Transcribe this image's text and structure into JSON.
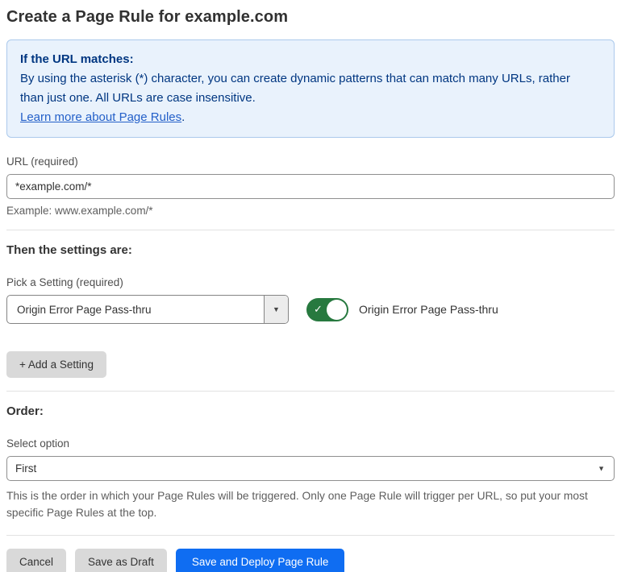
{
  "page": {
    "title": "Create a Page Rule for example.com"
  },
  "info_box": {
    "heading": "If the URL matches:",
    "body": "By using the asterisk (*) character, you can create dynamic patterns that can match many URLs, rather than just one. All URLs are case insensitive.",
    "link_label": "Learn more about Page Rules",
    "link_suffix": "."
  },
  "url_field": {
    "label": "URL (required)",
    "value": "*example.com/*",
    "helper": "Example: www.example.com/*"
  },
  "settings_section": {
    "heading": "Then the settings are:",
    "picker_label": "Pick a Setting (required)",
    "picker_value": "Origin Error Page Pass-thru",
    "toggle_state": "on",
    "toggle_label": "Origin Error Page Pass-thru",
    "add_setting_label": "+ Add a Setting"
  },
  "order_section": {
    "heading": "Order:",
    "select_label": "Select option",
    "select_value": "First",
    "helper": "This is the order in which your Page Rules will be triggered. Only one Page Rule will trigger per URL, so put your most specific Page Rules at the top."
  },
  "footer": {
    "cancel_label": "Cancel",
    "save_draft_label": "Save as Draft",
    "save_deploy_label": "Save and Deploy Page Rule"
  },
  "icons": {
    "chevron_down": "▼",
    "check": "✓"
  },
  "colors": {
    "accent_blue": "#0f6df2",
    "toggle_green": "#27793f",
    "info_background": "#e9f2fc",
    "info_border": "#abc9ec",
    "info_text": "#003681",
    "link_blue": "#2460c9",
    "button_gray": "#d9d9d9"
  }
}
